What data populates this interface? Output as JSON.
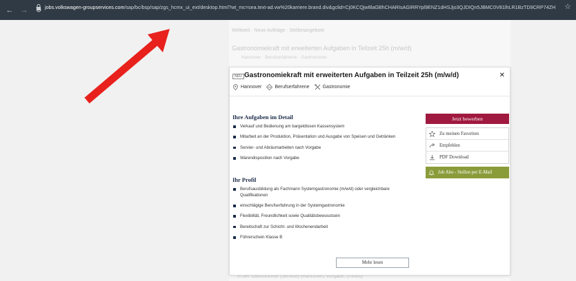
{
  "browser": {
    "back_icon": "arrow-left-icon",
    "forward_icon": "arrow-right-icon",
    "reload_icon": "reload-icon",
    "url_host": "jobs.volkswagen-groupservices.com",
    "url_path": "/sap/bc/bsp/sap/zgs_hcmx_ui_ext/desktop.html?wt_mc=sea.text-ad.vw%20karriere.brand.div&gclid=Cj0KCQjw8laGBhCHARIsAGIRRYpl9ENZ1dHSJjo3QJDIQn5JBMC0V81lhLR1BzTD9CRP74ZH0l0-MaAtIpEAL..."
  },
  "background": {
    "breadcrumb": "Weltweit   ·   Neue Aufträge   ·   Stellenangebote",
    "title": "Gastronomiekraft mit erweiterten Aufgaben in Teilzeit 25h (m/w/d)",
    "subtitle": "Hannover   ·   Berufserfahrene   ·   Gastronomie",
    "bottom": "In der Gastronomie (Service) (Hannover) Vorgabe, (m/w/d)"
  },
  "job": {
    "badge": "NEU",
    "title": "Gastronomiekraft mit erweiterten Aufgaben in Teilzeit 25h (m/w/d)",
    "location": "Hannover",
    "level": "Berufserfahrene",
    "field": "Gastronomie",
    "tasks_heading": "Ihre Aufgaben im Detail",
    "tasks": [
      "Verkauf und Bedienung am bargeldlosen Kassensystem",
      "Mitarbeit an der Produktion, Präsentation und Ausgabe von Speisen und Getränken",
      "Servier- und Abräumarbeiten nach Vorgabe",
      "Warendisposition nach Vorgabe"
    ],
    "profile_heading": "Ihr Profil",
    "profile": [
      "Berufsausbildung als Fachmann Systemgastronomie (m/w/d) oder vergleichbare Qualifikationen",
      "einschlägige Berufserfahrung in der Systemgastronomie",
      "Flexibilität, Freundlichkeit sowie Qualitätsbewusstsein",
      "Bereitschaft zur Schicht- und Wochenendarbeit",
      "Führerschein Klasse B"
    ],
    "apply_label": "Jetzt bewerben",
    "favorites_label": "Zu meinen Favoriten",
    "recommend_label": "Empfehlen",
    "pdf_label": "PDF Download",
    "jobabo_label": "Job Abo - Stellen per E-Mail",
    "more_label": "Mehr lesen",
    "close_symbol": "✕"
  },
  "colors": {
    "apply": "#a0193f",
    "jobabo": "#8a9c3a",
    "heading": "#1b2b48",
    "arrow": "#e8211d"
  }
}
